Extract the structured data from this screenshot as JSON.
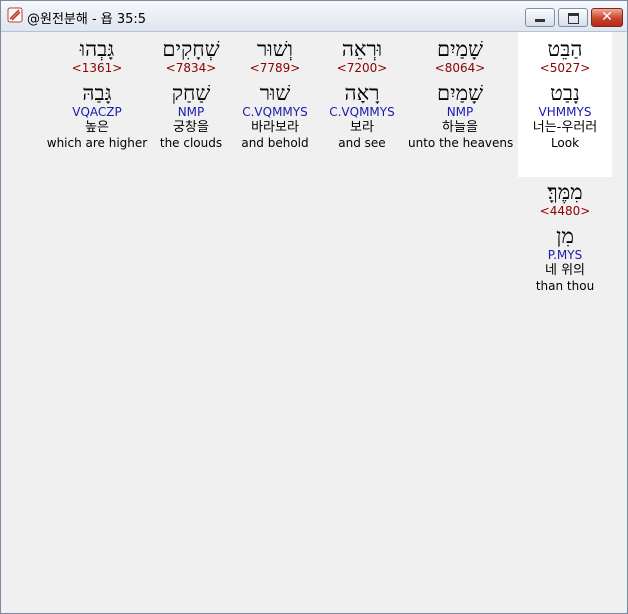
{
  "window": {
    "title": "@원전분해 - 욥 35:5",
    "icon": "app-scroll-icon",
    "controls": {
      "minimize": "minimize-icon",
      "maximize": "maximize-icon",
      "close": "✕"
    }
  },
  "words": [
    {
      "hebrew": "הַבֵּט",
      "strong": "<5027>",
      "lemma": "נָבַט",
      "parse": "VHMMYS",
      "korean": "너는-우러러",
      "english": "Look",
      "selected": true
    },
    {
      "hebrew": "שָׁמַיִם",
      "strong": "<8064>",
      "lemma": "שָׁמַיִם",
      "parse": "NMP",
      "korean": "하늘을",
      "english": "unto the heavens",
      "selected": false
    },
    {
      "hebrew": "וּרְאֵה",
      "strong": "<7200>",
      "lemma": "רָאָה",
      "parse": "C.VQMMYS",
      "korean": "보라",
      "english": "and see",
      "selected": false
    },
    {
      "hebrew": "וְשׁוּר",
      "strong": "<7789>",
      "lemma": "שׁוּר",
      "parse": "C.VQMMYS",
      "korean": "바라보라",
      "english": "and behold",
      "selected": false
    },
    {
      "hebrew": "שְׁחָקִים",
      "strong": "<7834>",
      "lemma": "שַׁחַק",
      "parse": "NMP",
      "korean": "궁창을",
      "english": "the clouds",
      "selected": false
    },
    {
      "hebrew": "גָּבְהוּ",
      "strong": "<1361>",
      "lemma": "גָּבַהּ",
      "parse": "VQACZP",
      "korean": "높은",
      "english": "which are higher",
      "selected": false
    },
    {
      "hebrew": "מִמֶּךָּ׃",
      "strong": "<4480>",
      "lemma": "מִן",
      "parse": "P.MYS",
      "korean": "네 위의",
      "english": "than thou",
      "selected": false
    }
  ]
}
